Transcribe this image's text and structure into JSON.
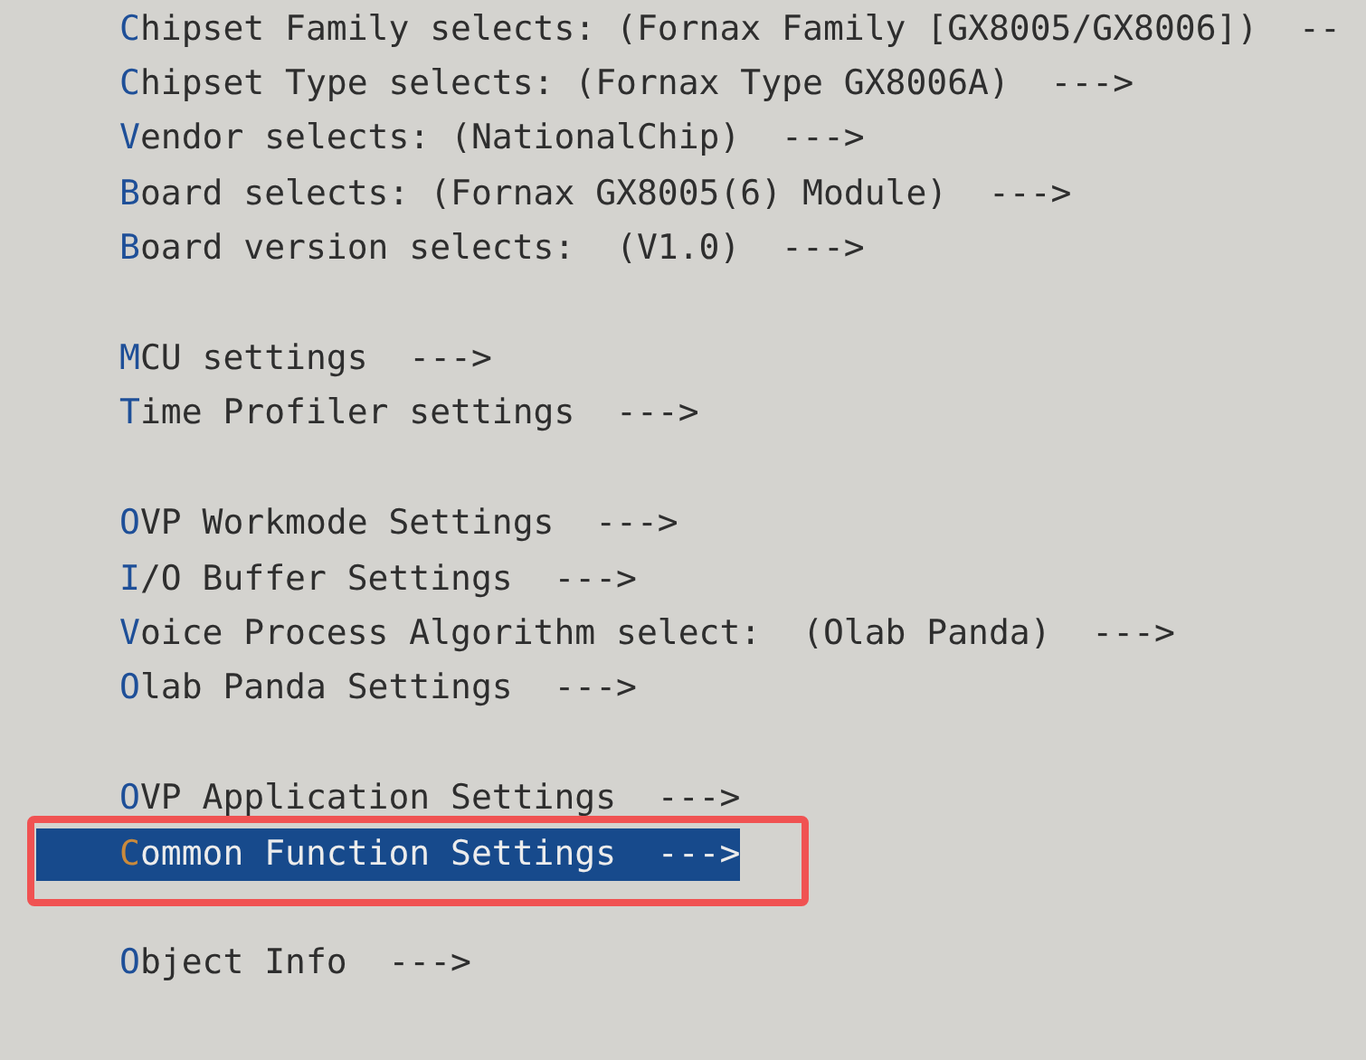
{
  "menu": {
    "sections": [
      {
        "items": [
          {
            "label": "Chipset Family selects: (Fornax Family [GX8005/GX8006])",
            "arrow": "--",
            "selected": false
          },
          {
            "label": "Chipset Type selects: (Fornax Type GX8006A)",
            "arrow": "--->",
            "selected": false
          },
          {
            "label": "Vendor selects: (NationalChip)",
            "arrow": "--->",
            "selected": false
          },
          {
            "label": "Board selects: (Fornax GX8005(6) Module)",
            "arrow": "--->",
            "selected": false
          },
          {
            "label": "Board version selects:  (V1.0)",
            "arrow": "--->",
            "selected": false
          }
        ]
      },
      {
        "items": [
          {
            "label": "MCU settings",
            "arrow": "--->",
            "selected": false
          },
          {
            "label": "Time Profiler settings",
            "arrow": "--->",
            "selected": false
          }
        ]
      },
      {
        "items": [
          {
            "label": "OVP Workmode Settings",
            "arrow": "--->",
            "selected": false
          },
          {
            "label": "I/O Buffer Settings",
            "arrow": "--->",
            "selected": false
          },
          {
            "label": "Voice Process Algorithm select:  (Olab Panda)",
            "arrow": "--->",
            "selected": false
          },
          {
            "label": "Olab Panda Settings",
            "arrow": "--->",
            "selected": false
          }
        ]
      },
      {
        "items": [
          {
            "label": "OVP Application Settings",
            "arrow": "--->",
            "selected": false
          },
          {
            "label": "Common Function Settings",
            "arrow": "--->",
            "selected": true
          }
        ]
      },
      {
        "items": [
          {
            "label": "Object Info",
            "arrow": "--->",
            "selected": false
          }
        ]
      }
    ]
  }
}
